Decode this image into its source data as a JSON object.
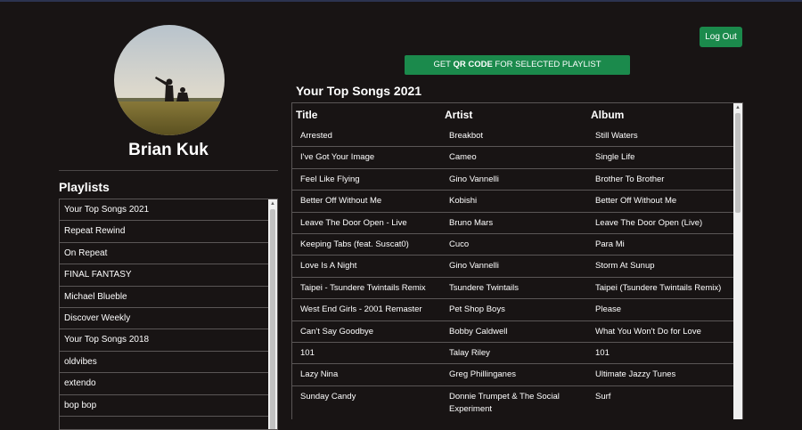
{
  "user": {
    "name": "Brian Kuk"
  },
  "header": {
    "logout_label": "Log Out"
  },
  "qr_button": {
    "prefix": "GET ",
    "bold": "QR CODE",
    "suffix": " FOR SELECTED PLAYLIST"
  },
  "sidebar": {
    "heading": "Playlists",
    "items": [
      {
        "label": "Your Top Songs 2021"
      },
      {
        "label": "Repeat Rewind"
      },
      {
        "label": "On Repeat"
      },
      {
        "label": "FINAL FANTASY"
      },
      {
        "label": "Michael Blueble"
      },
      {
        "label": "Discover Weekly"
      },
      {
        "label": "Your Top Songs 2018"
      },
      {
        "label": "oldvibes"
      },
      {
        "label": "extendo"
      },
      {
        "label": "bop bop"
      },
      {
        "label": ""
      }
    ]
  },
  "songs": {
    "title": "Your Top Songs 2021",
    "columns": {
      "title": "Title",
      "artist": "Artist",
      "album": "Album"
    },
    "rows": [
      {
        "title": "Arrested",
        "artist": "Breakbot",
        "album": "Still Waters"
      },
      {
        "title": "I've Got Your Image",
        "artist": "Cameo",
        "album": "Single Life"
      },
      {
        "title": "Feel Like Flying",
        "artist": "Gino Vannelli",
        "album": "Brother To Brother"
      },
      {
        "title": "Better Off Without Me",
        "artist": "Kobishi",
        "album": "Better Off Without Me"
      },
      {
        "title": "Leave The Door Open - Live",
        "artist": "Bruno Mars",
        "album": "Leave The Door Open (Live)"
      },
      {
        "title": "Keeping Tabs (feat. Suscat0)",
        "artist": "Cuco",
        "album": "Para Mi"
      },
      {
        "title": "Love Is A Night",
        "artist": "Gino Vannelli",
        "album": "Storm At Sunup"
      },
      {
        "title": "Taipei - Tsundere Twintails Remix",
        "artist": "Tsundere Twintails",
        "album": "Taipei (Tsundere Twintails Remix)"
      },
      {
        "title": "West End Girls - 2001 Remaster",
        "artist": "Pet Shop Boys",
        "album": "Please"
      },
      {
        "title": "Can't Say Goodbye",
        "artist": "Bobby Caldwell",
        "album": "What You Won't Do for Love"
      },
      {
        "title": "101",
        "artist": "Talay Riley",
        "album": "101"
      },
      {
        "title": "Lazy Nina",
        "artist": "Greg Phillinganes",
        "album": "Ultimate Jazzy Tunes"
      },
      {
        "title": "Sunday Candy",
        "artist": "Donnie Trumpet & The Social Experiment",
        "album": "Surf"
      }
    ]
  },
  "colors": {
    "background": "#181414",
    "accent": "#1b8a4c"
  }
}
